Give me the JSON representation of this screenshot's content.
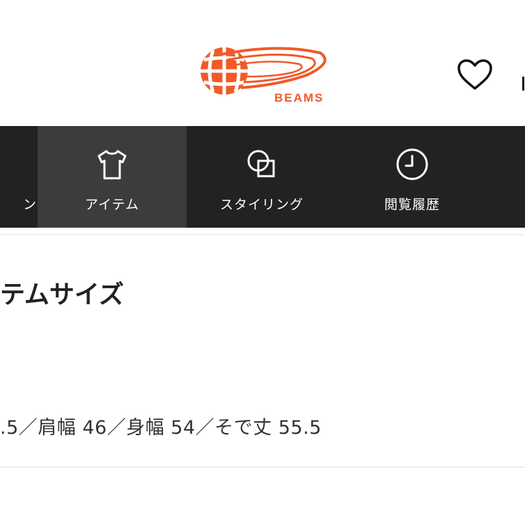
{
  "header": {
    "logo_text": "BEAMS",
    "brand_color": "#f05a28"
  },
  "nav": {
    "left_partial_label": "ン",
    "items": [
      {
        "label": "アイテム",
        "icon": "tshirt-icon",
        "active": true
      },
      {
        "label": "スタイリング",
        "icon": "overlap-squares-icon",
        "active": false
      },
      {
        "label": "閲覧履歴",
        "icon": "clock-icon",
        "active": false
      }
    ],
    "background": "#222222",
    "active_background": "#3c3c3c"
  },
  "main": {
    "section_title": "テムサイズ",
    "size_text": ".5／肩幅 46／身幅 54／そで丈 55.5"
  }
}
